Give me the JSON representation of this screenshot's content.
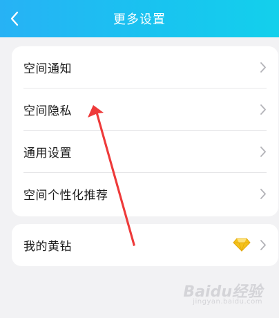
{
  "header": {
    "title": "更多设置",
    "back_icon": "chevron-left-icon"
  },
  "settings_group": {
    "items": [
      {
        "label": "空间通知"
      },
      {
        "label": "空间隐私"
      },
      {
        "label": "通用设置"
      },
      {
        "label": "空间个性化推荐"
      }
    ]
  },
  "vip_group": {
    "label": "我的黄钻",
    "icon": "yellow-diamond-icon"
  },
  "watermark": {
    "text": "Baidu经验",
    "sub": "jingyan.baidu.com"
  },
  "colors": {
    "header_start": "#27b2f5",
    "header_end": "#13d0ec",
    "annotation_arrow": "#ee3a3a",
    "diamond": "#f5c21b"
  }
}
